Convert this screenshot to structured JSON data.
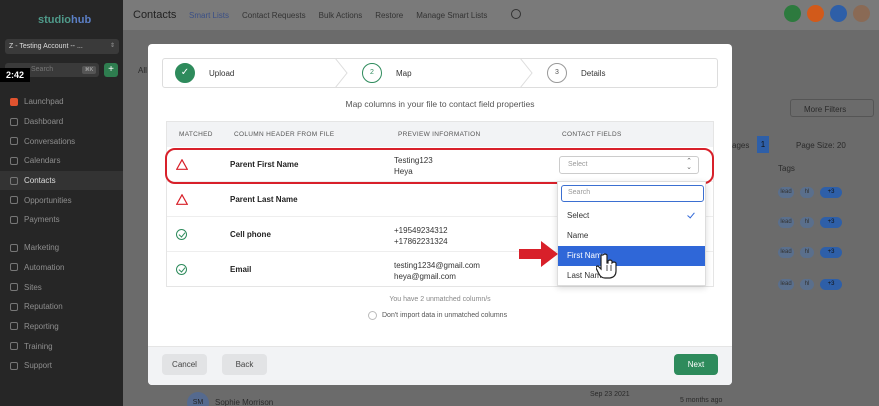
{
  "app": {
    "logo": {
      "part1": "studio",
      "part2": "hub"
    },
    "account": "Z - Testing Account -- ...",
    "search_placeholder": "Search",
    "search_shortcut": "⌘K",
    "timer": "2:42"
  },
  "sidebar": {
    "items": [
      {
        "label": "Launchpad",
        "icon": "rocket-icon"
      },
      {
        "label": "Dashboard",
        "icon": "dashboard-icon"
      },
      {
        "label": "Conversations",
        "icon": "chat-icon"
      },
      {
        "label": "Calendars",
        "icon": "calendar-icon"
      },
      {
        "label": "Contacts",
        "icon": "contacts-icon",
        "active": true
      },
      {
        "label": "Opportunities",
        "icon": "funnel-icon"
      },
      {
        "label": "Payments",
        "icon": "payments-icon"
      }
    ],
    "items2": [
      {
        "label": "Marketing",
        "icon": "marketing-icon"
      },
      {
        "label": "Automation",
        "icon": "automation-icon"
      },
      {
        "label": "Sites",
        "icon": "sites-icon"
      },
      {
        "label": "Reputation",
        "icon": "star-icon"
      },
      {
        "label": "Reporting",
        "icon": "chart-icon"
      },
      {
        "label": "Training",
        "icon": "book-icon"
      },
      {
        "label": "Support",
        "icon": "support-icon"
      }
    ]
  },
  "header": {
    "title": "Contacts",
    "tabs": [
      "Smart Lists",
      "Contact Requests",
      "Bulk Actions",
      "Restore",
      "Manage Smart Lists"
    ]
  },
  "background": {
    "more_filters": "More Filters",
    "pages_label": "ages",
    "page_num": "1",
    "page_size": "Page Size: 20",
    "tags_header": "Tags",
    "tag_lead": "lead",
    "tag_hl": "hl",
    "tag_more": "+3",
    "all_tab": "All",
    "contact_name": "Sophie Morrison",
    "contact_initials": "SM",
    "contact_date": "Sep 23 2021",
    "contact_ago": "5 months ago"
  },
  "modal": {
    "steps": [
      {
        "num": "✓",
        "label": "Upload"
      },
      {
        "num": "2",
        "label": "Map"
      },
      {
        "num": "3",
        "label": "Details"
      }
    ],
    "subtitle": "Map columns in your file to contact field properties",
    "columns": [
      "MATCHED",
      "COLUMN HEADER FROM FILE",
      "PREVIEW INFORMATION",
      "CONTACT FIELDS"
    ],
    "rows": [
      {
        "status": "warning",
        "name": "Parent First Name",
        "preview1": "Testing123",
        "preview2": "Heya",
        "field": "Select"
      },
      {
        "status": "warning",
        "name": "Parent Last Name",
        "preview1": "",
        "preview2": "",
        "field": ""
      },
      {
        "status": "ok",
        "name": "Cell phone",
        "preview1": "+19549234312",
        "preview2": "+17862231324",
        "field": ""
      },
      {
        "status": "ok",
        "name": "Email",
        "preview1": "testing1234@gmail.com",
        "preview2": "heya@gmail.com",
        "field": ""
      }
    ],
    "dropdown": {
      "search_placeholder": "Search",
      "options": [
        "Select",
        "Name",
        "First Name",
        "Last Name"
      ],
      "selected": "Select",
      "hovered": "First Name"
    },
    "unmatched_text": "You have 2 unmatched column/s",
    "dont_import": "Don't import data in unmatched columns",
    "cancel": "Cancel",
    "back": "Back",
    "next": "Next"
  },
  "colors": {
    "accent_green": "#2e8b5c",
    "highlight_red": "#d8202a",
    "dropdown_blue": "#2f67d8"
  }
}
